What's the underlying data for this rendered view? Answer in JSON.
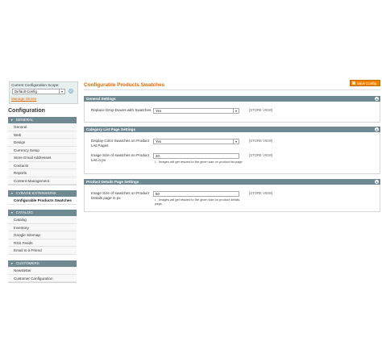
{
  "sidebar": {
    "scope_label": "Current Configuration Scope:",
    "scope_value": "Default Config",
    "help_icon": "?",
    "manage_stores": "Manage Stores",
    "config_title": "Configuration",
    "sections": [
      {
        "title": "GENERAL",
        "items": [
          "General",
          "Web",
          "Design",
          "Currency Setup",
          "Store Email Addresses",
          "Contacts",
          "Reports",
          "Content Management"
        ]
      },
      {
        "title": "CYBAGE EXTENSIONS",
        "items": [
          "Configurable Products Swatches"
        ]
      },
      {
        "title": "CATALOG",
        "items": [
          "Catalog",
          "Inventory",
          "Google Sitemap",
          "RSS Feeds",
          "Email to a Friend"
        ]
      },
      {
        "title": "CUSTOMERS",
        "items": [
          "Newsletter",
          "Customer Configuration"
        ]
      }
    ]
  },
  "main": {
    "title": "Configurable Products Swatches",
    "save_label": "Save Config",
    "fieldsets": [
      {
        "title": "General Settings",
        "rows": [
          {
            "label": "Replace Drop-Downs with Swatches",
            "value": "Yes",
            "scope": "[STORE VIEW]"
          }
        ]
      },
      {
        "title": "Category List Page Settings",
        "rows": [
          {
            "label": "Display Color Swatches on Product List Pages",
            "value": "Yes",
            "scope": "[STORE VIEW]"
          },
          {
            "label": "Image Size of swatches on Product List in px",
            "value": "20",
            "scope": "[STORE VIEW]",
            "hint": "Images will get resized to the given size on product list page."
          }
        ]
      },
      {
        "title": "Product Details Page Settings",
        "rows": [
          {
            "label": "Image Size of swatches on Product Details page in px",
            "value": "50",
            "scope": "[STORE VIEW]",
            "hint": "Images will get resized to the given size on product details page."
          }
        ]
      }
    ]
  },
  "colors": {
    "accent": "#e26703",
    "section_header": "#6f8992",
    "save_button": "#f18200"
  }
}
